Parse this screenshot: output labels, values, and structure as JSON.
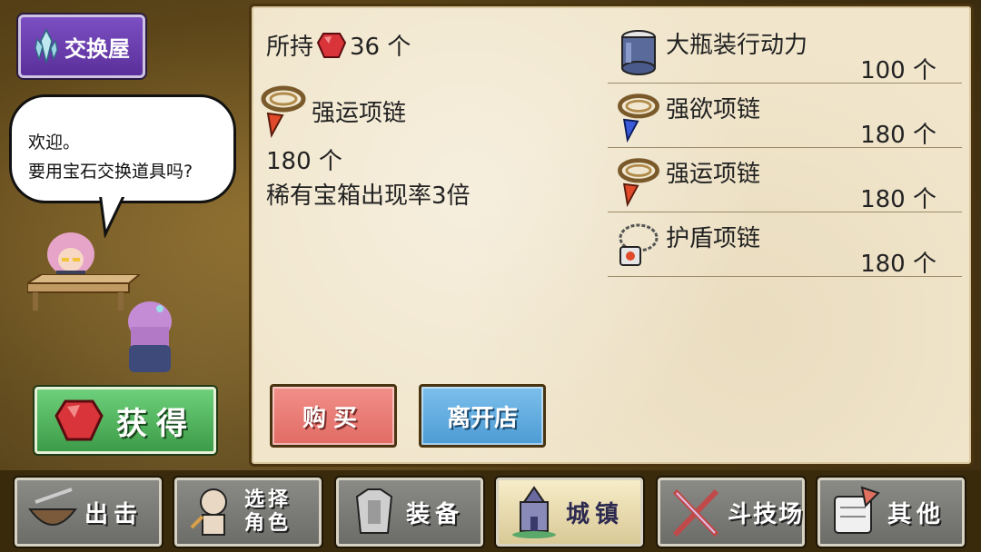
{
  "shop": {
    "title": "交换屋"
  },
  "dialog": {
    "line1": "欢迎。",
    "line2": "要用宝石交换道具吗?"
  },
  "obtain_button": {
    "label": "获得"
  },
  "owned": {
    "prefix": "所持",
    "amount": "36 个"
  },
  "selected_item": {
    "name": "强运项链",
    "price": "180 个",
    "description": "稀有宝箱出现率3倍"
  },
  "items": [
    {
      "name": "大瓶装行动力",
      "price": "100 个",
      "icon": "potion-jar-icon"
    },
    {
      "name": "强欲项链",
      "price": "180 个",
      "icon": "blue-necklace-icon"
    },
    {
      "name": "强运项链",
      "price": "180 个",
      "icon": "red-necklace-icon"
    },
    {
      "name": "护盾项链",
      "price": "180 个",
      "icon": "shield-necklace-icon"
    }
  ],
  "actions": {
    "buy": "购买",
    "leave": "离开店"
  },
  "nav": {
    "sortie": "出击",
    "select_line1": "选择",
    "select_line2": "角色",
    "equip": "装备",
    "town": "城镇",
    "arena": "斗技场",
    "other": "其他"
  },
  "colors": {
    "panel": "#f1e6cc",
    "buy": "#e16b64",
    "leave": "#4c9bd4",
    "obtain": "#3c9b48",
    "shop_badge": "#5b2f9a",
    "active_nav": "#f6ecc8"
  }
}
